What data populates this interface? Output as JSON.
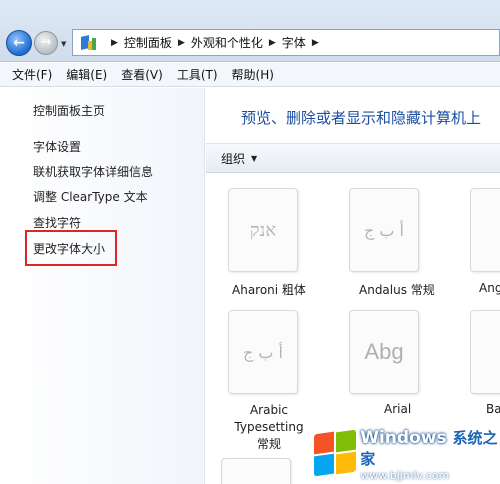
{
  "address": {
    "crumbs": [
      "控制面板",
      "外观和个性化",
      "字体"
    ]
  },
  "menu": [
    "文件(F)",
    "编辑(E)",
    "查看(V)",
    "工具(T)",
    "帮助(H)"
  ],
  "tasks": {
    "home": "控制面板主页",
    "font_settings": "字体设置",
    "online_info": "联机获取字体详细信息",
    "cleartype": "调整 ClearType 文本",
    "find_char": "查找字符",
    "change_size": "更改字体大小"
  },
  "main": {
    "headline": "预览、删除或者显示和隐藏计算机上",
    "organize": "组织"
  },
  "fonts": [
    {
      "preview": "אנק",
      "name": "Aharoni 粗体"
    },
    {
      "preview": "أ ب ج",
      "name": "Andalus 常规"
    },
    {
      "preview": "",
      "name": "Ang"
    },
    {
      "preview": "أ ب ج",
      "name": "Arabic Typesetting 常规"
    },
    {
      "preview": "Abg",
      "name": "Arial"
    },
    {
      "preview": "",
      "name": "Ba"
    }
  ],
  "watermark": {
    "brand": "Windows",
    "suffix": "系统之家",
    "url": "www.bjjmlv.com"
  },
  "colors": {
    "accent": "#1d4fa3",
    "highlight": "#e0252a"
  }
}
